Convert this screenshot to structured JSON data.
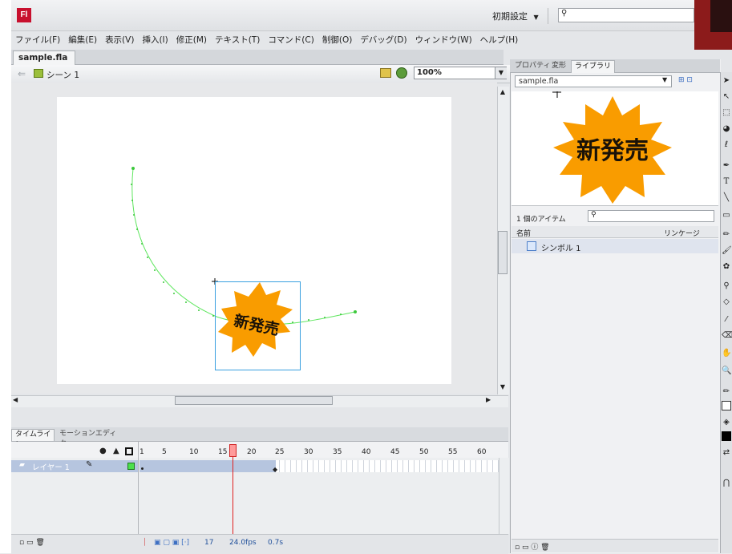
{
  "app": {
    "logo": "Fl",
    "workspace": "初期設定",
    "workspace_arrow": "▼"
  },
  "menu": [
    "ファイル(F)",
    "編集(E)",
    "表示(V)",
    "挿入(I)",
    "修正(M)",
    "テキスト(T)",
    "コマンド(C)",
    "制御(O)",
    "デバッグ(D)",
    "ウィンドウ(W)",
    "ヘルプ(H)"
  ],
  "document": {
    "tab": "sample.fla ×",
    "scene": "シーン 1",
    "zoom": "100%"
  },
  "stage": {
    "symbol_text": "新発売",
    "accent": "#f99c00",
    "motion_path_color": "#5ee65e",
    "selection_color": "#3aa0e0"
  },
  "timeline": {
    "tabs": [
      "タイムライン",
      "モーションエディタ"
    ],
    "layer": "レイヤー 1",
    "ruler": [
      "1",
      "5",
      "10",
      "15",
      "20",
      "25",
      "30",
      "35",
      "40",
      "45",
      "50",
      "55",
      "60"
    ],
    "frame": "17",
    "fps": "24.0fps",
    "time": "0.7s",
    "playhead_frame": 17,
    "tween_end_frame": 24
  },
  "panel": {
    "tabs": [
      "プロパティ",
      "変形",
      "ライブラリ"
    ],
    "library_doc": "sample.fla",
    "item_count": "1 個のアイテム",
    "col_name": "名前",
    "col_linkage": "リンケージ",
    "item": "シンボル 1",
    "preview_text": "新発売"
  }
}
